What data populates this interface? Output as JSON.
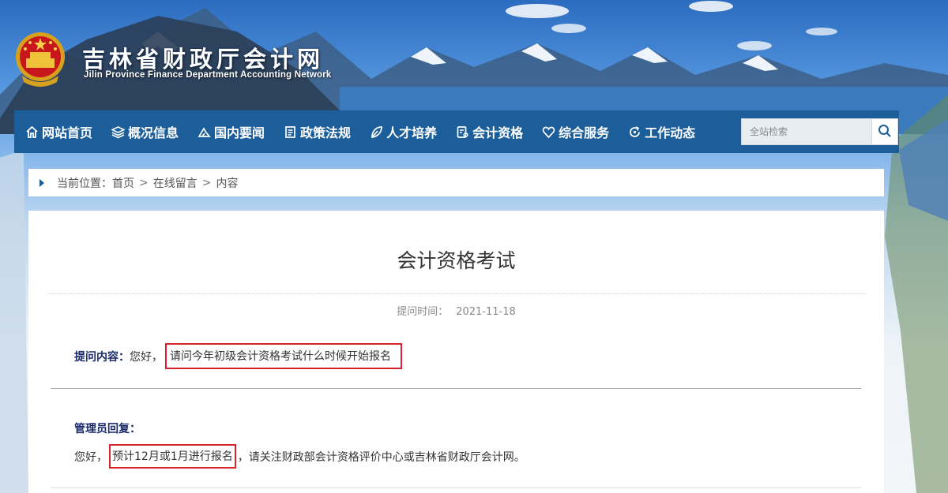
{
  "header": {
    "title": "吉林省财政厅会计网",
    "subtitle": "Jilin Province Finance Department Accounting Network",
    "emblem_icon": "national-emblem-icon"
  },
  "nav": {
    "items": [
      {
        "label": "网站首页",
        "icon": "home-icon"
      },
      {
        "label": "概况信息",
        "icon": "layers-icon"
      },
      {
        "label": "国内要闻",
        "icon": "news-icon"
      },
      {
        "label": "政策法规",
        "icon": "document-icon"
      },
      {
        "label": "人才培养",
        "icon": "leaf-icon"
      },
      {
        "label": "会计资格",
        "icon": "certificate-icon"
      },
      {
        "label": "综合服务",
        "icon": "heart-icon"
      },
      {
        "label": "工作动态",
        "icon": "refresh-icon"
      }
    ],
    "search": {
      "placeholder": "全站检索",
      "button_icon": "search-icon"
    }
  },
  "breadcrumb": {
    "prefix": "当前位置：",
    "items": [
      "首页",
      "在线留言",
      "内容"
    ],
    "separator": ">"
  },
  "article": {
    "title": "会计资格考试",
    "meta_label": "提问时间：",
    "meta_date": "2021-11-18",
    "question_label": "提问内容：",
    "question_prefix": "您好，",
    "question_highlight": "请问今年初级会计资格考试什么时候开始报名",
    "reply_label": "管理员回复：",
    "reply_prefix": "您好，",
    "reply_highlight": "预计12月或1月进行报名",
    "reply_suffix": "，请关注财政部会计资格评价中心或吉林省财政厅会计网。"
  },
  "colors": {
    "nav_bg": "#1c5e9a",
    "highlight_border": "#d8232a",
    "label_color": "#1a2a6b"
  }
}
